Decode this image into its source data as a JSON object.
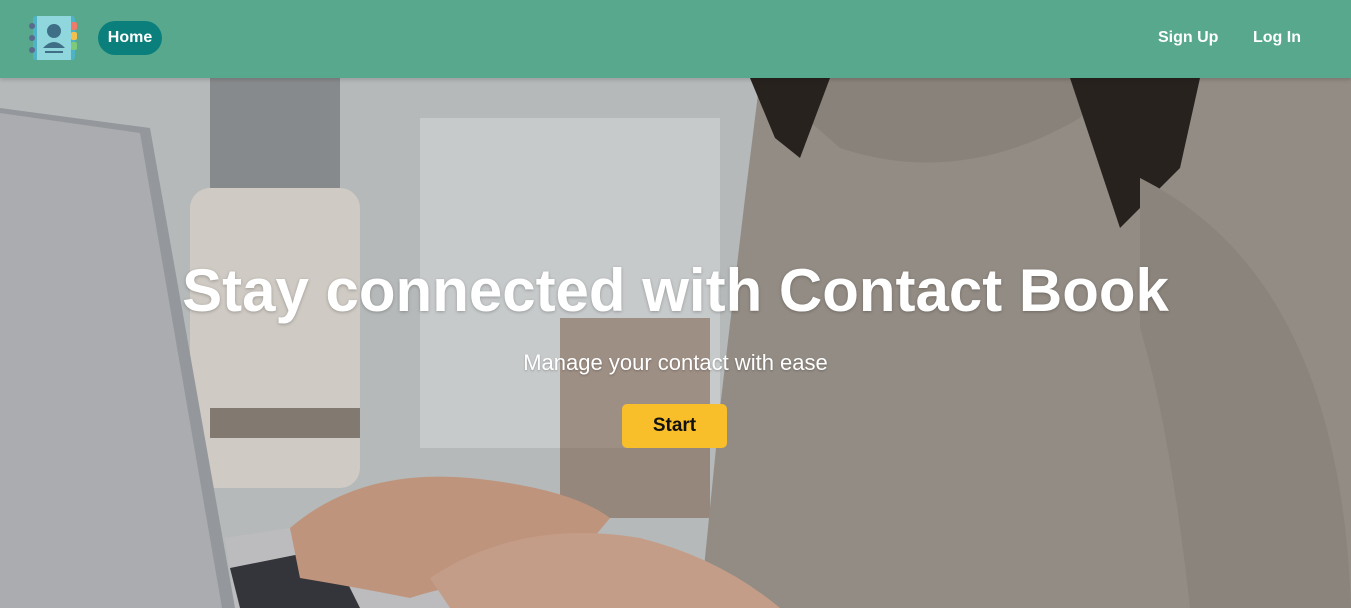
{
  "navbar": {
    "logo_icon": "contact-book-icon",
    "home_label": "Home",
    "signup_label": "Sign Up",
    "login_label": "Log In"
  },
  "hero": {
    "title": "Stay connected with Contact Book",
    "subtitle": "Manage your contact with ease",
    "start_label": "Start"
  },
  "colors": {
    "navbar_bg": "#57a88c",
    "home_button_bg": "#0b7f7c",
    "start_button_bg": "#f9bf2a"
  }
}
